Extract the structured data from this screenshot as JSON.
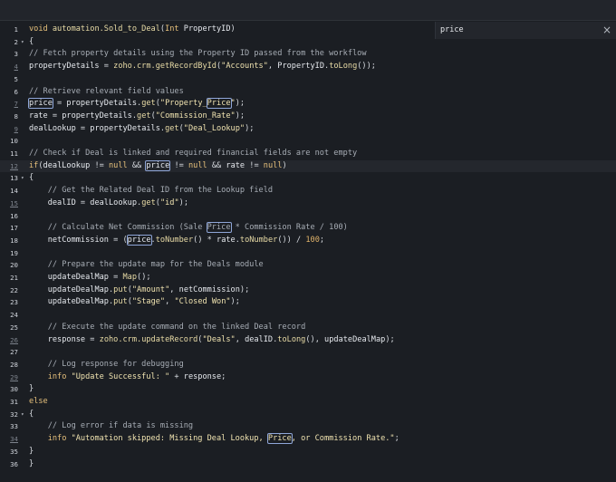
{
  "search": {
    "value": "price",
    "close_label": "×"
  },
  "editor": {
    "lines": [
      {
        "n": "1",
        "fold": false,
        "tokens": [
          [
            "kw",
            "void "
          ],
          [
            "fn",
            "automation.Sold_to_Deal"
          ],
          [
            "op",
            "("
          ],
          [
            "kw",
            "Int "
          ],
          [
            "var",
            "PropertyID"
          ],
          [
            "op",
            ")"
          ]
        ]
      },
      {
        "n": "2",
        "fold": true,
        "tokens": [
          [
            "op",
            "{"
          ]
        ]
      },
      {
        "n": "3",
        "fold": false,
        "tokens": [
          [
            "cm",
            "// Fetch property details using the Property ID passed from the workflow"
          ]
        ]
      },
      {
        "n": "4",
        "fold": false,
        "tokens": [
          [
            "var",
            "propertyDetails"
          ],
          [
            "op",
            " = "
          ],
          [
            "fn",
            "zoho.crm.getRecordById"
          ],
          [
            "op",
            "("
          ],
          [
            "str",
            "\"Accounts\""
          ],
          [
            "op",
            ", "
          ],
          [
            "var",
            "PropertyID"
          ],
          [
            "op",
            "."
          ],
          [
            "fn",
            "toLong"
          ],
          [
            "op",
            "());"
          ]
        ]
      },
      {
        "n": "5",
        "fold": false,
        "tokens": []
      },
      {
        "n": "6",
        "fold": false,
        "tokens": [
          [
            "cm",
            "// Retrieve relevant field values"
          ]
        ]
      },
      {
        "n": "7",
        "fold": false,
        "tokens": [
          [
            "hl",
            "price"
          ],
          [
            "op",
            " = "
          ],
          [
            "var",
            "propertyDetails"
          ],
          [
            "op",
            "."
          ],
          [
            "fn",
            "get"
          ],
          [
            "op",
            "("
          ],
          [
            "str",
            "\"Property_"
          ],
          [
            "hlstr",
            "Price"
          ],
          [
            "str",
            "\""
          ],
          [
            "op",
            ");"
          ]
        ]
      },
      {
        "n": "8",
        "fold": false,
        "tokens": [
          [
            "var",
            "rate"
          ],
          [
            "op",
            " = "
          ],
          [
            "var",
            "propertyDetails"
          ],
          [
            "op",
            "."
          ],
          [
            "fn",
            "get"
          ],
          [
            "op",
            "("
          ],
          [
            "str",
            "\"Commission_Rate\""
          ],
          [
            "op",
            ");"
          ]
        ]
      },
      {
        "n": "9",
        "fold": false,
        "tokens": [
          [
            "var",
            "dealLookup"
          ],
          [
            "op",
            " = "
          ],
          [
            "var",
            "propertyDetails"
          ],
          [
            "op",
            "."
          ],
          [
            "fn",
            "get"
          ],
          [
            "op",
            "("
          ],
          [
            "str",
            "\"Deal_Lookup\""
          ],
          [
            "op",
            ");"
          ]
        ]
      },
      {
        "n": "10",
        "fold": false,
        "tokens": []
      },
      {
        "n": "11",
        "fold": false,
        "tokens": [
          [
            "cm",
            "// Check if Deal is linked and required financial fields are not empty"
          ]
        ]
      },
      {
        "n": "12",
        "fold": false,
        "active": true,
        "tokens": [
          [
            "kw",
            "if"
          ],
          [
            "op",
            "("
          ],
          [
            "var",
            "dealLookup"
          ],
          [
            "op",
            " != "
          ],
          [
            "kw",
            "null"
          ],
          [
            "op",
            " && "
          ],
          [
            "hl",
            "price"
          ],
          [
            "op",
            " != "
          ],
          [
            "kw",
            "null"
          ],
          [
            "op",
            " && "
          ],
          [
            "var",
            "rate"
          ],
          [
            "op",
            " != "
          ],
          [
            "kw",
            "null"
          ],
          [
            "op",
            ")"
          ]
        ]
      },
      {
        "n": "13",
        "fold": true,
        "tokens": [
          [
            "op",
            "{"
          ]
        ]
      },
      {
        "n": "14",
        "fold": false,
        "tokens": [
          [
            "op",
            "    "
          ],
          [
            "cm",
            "// Get the Related Deal ID from the Lookup field"
          ]
        ]
      },
      {
        "n": "15",
        "fold": false,
        "tokens": [
          [
            "op",
            "    "
          ],
          [
            "var",
            "dealID"
          ],
          [
            "op",
            " = "
          ],
          [
            "var",
            "dealLookup"
          ],
          [
            "op",
            "."
          ],
          [
            "fn",
            "get"
          ],
          [
            "op",
            "("
          ],
          [
            "str",
            "\"id\""
          ],
          [
            "op",
            ");"
          ]
        ]
      },
      {
        "n": "16",
        "fold": false,
        "tokens": []
      },
      {
        "n": "17",
        "fold": false,
        "tokens": [
          [
            "op",
            "    "
          ],
          [
            "cm",
            "// Calculate Net Commission (Sale "
          ],
          [
            "hlcm",
            "Price"
          ],
          [
            "cm",
            " * Commission Rate / 100)"
          ]
        ]
      },
      {
        "n": "18",
        "fold": false,
        "tokens": [
          [
            "op",
            "    "
          ],
          [
            "var",
            "netCommission"
          ],
          [
            "op",
            " = ("
          ],
          [
            "hl",
            "price"
          ],
          [
            "op",
            "."
          ],
          [
            "fn",
            "toNumber"
          ],
          [
            "op",
            "() * "
          ],
          [
            "var",
            "rate"
          ],
          [
            "op",
            "."
          ],
          [
            "fn",
            "toNumber"
          ],
          [
            "op",
            "()) / "
          ],
          [
            "num",
            "100"
          ],
          [
            "op",
            ";"
          ]
        ]
      },
      {
        "n": "19",
        "fold": false,
        "tokens": []
      },
      {
        "n": "20",
        "fold": false,
        "tokens": [
          [
            "op",
            "    "
          ],
          [
            "cm",
            "// Prepare the update map for the Deals module"
          ]
        ]
      },
      {
        "n": "21",
        "fold": false,
        "tokens": [
          [
            "op",
            "    "
          ],
          [
            "var",
            "updateDealMap"
          ],
          [
            "op",
            " = "
          ],
          [
            "fn",
            "Map"
          ],
          [
            "op",
            "();"
          ]
        ]
      },
      {
        "n": "22",
        "fold": false,
        "tokens": [
          [
            "op",
            "    "
          ],
          [
            "var",
            "updateDealMap"
          ],
          [
            "op",
            "."
          ],
          [
            "fn",
            "put"
          ],
          [
            "op",
            "("
          ],
          [
            "str",
            "\"Amount\""
          ],
          [
            "op",
            ", "
          ],
          [
            "var",
            "netCommission"
          ],
          [
            "op",
            ");"
          ]
        ]
      },
      {
        "n": "23",
        "fold": false,
        "tokens": [
          [
            "op",
            "    "
          ],
          [
            "var",
            "updateDealMap"
          ],
          [
            "op",
            "."
          ],
          [
            "fn",
            "put"
          ],
          [
            "op",
            "("
          ],
          [
            "str",
            "\"Stage\""
          ],
          [
            "op",
            ", "
          ],
          [
            "str",
            "\"Closed Won\""
          ],
          [
            "op",
            ");"
          ]
        ]
      },
      {
        "n": "24",
        "fold": false,
        "tokens": []
      },
      {
        "n": "25",
        "fold": false,
        "tokens": [
          [
            "op",
            "    "
          ],
          [
            "cm",
            "// Execute the update command on the linked Deal record"
          ]
        ]
      },
      {
        "n": "26",
        "fold": false,
        "tokens": [
          [
            "op",
            "    "
          ],
          [
            "var",
            "response"
          ],
          [
            "op",
            " = "
          ],
          [
            "fn",
            "zoho.crm.updateRecord"
          ],
          [
            "op",
            "("
          ],
          [
            "str",
            "\"Deals\""
          ],
          [
            "op",
            ", "
          ],
          [
            "var",
            "dealID"
          ],
          [
            "op",
            "."
          ],
          [
            "fn",
            "toLong"
          ],
          [
            "op",
            "(), "
          ],
          [
            "var",
            "updateDealMap"
          ],
          [
            "op",
            ");"
          ]
        ]
      },
      {
        "n": "27",
        "fold": false,
        "tokens": []
      },
      {
        "n": "28",
        "fold": false,
        "tokens": [
          [
            "op",
            "    "
          ],
          [
            "cm",
            "// Log response for debugging"
          ]
        ]
      },
      {
        "n": "29",
        "fold": false,
        "tokens": [
          [
            "op",
            "    "
          ],
          [
            "kw",
            "info "
          ],
          [
            "str",
            "\"Update Successful: \""
          ],
          [
            "op",
            " + "
          ],
          [
            "var",
            "response"
          ],
          [
            "op",
            ";"
          ]
        ]
      },
      {
        "n": "30",
        "fold": false,
        "tokens": [
          [
            "op",
            "}"
          ]
        ]
      },
      {
        "n": "31",
        "fold": false,
        "tokens": [
          [
            "kw",
            "else"
          ]
        ]
      },
      {
        "n": "32",
        "fold": true,
        "tokens": [
          [
            "op",
            "{"
          ]
        ]
      },
      {
        "n": "33",
        "fold": false,
        "tokens": [
          [
            "op",
            "    "
          ],
          [
            "cm",
            "// Log error if data is missing"
          ]
        ]
      },
      {
        "n": "34",
        "fold": false,
        "tokens": [
          [
            "op",
            "    "
          ],
          [
            "kw",
            "info "
          ],
          [
            "str",
            "\"Automation skipped: Missing Deal Lookup, "
          ],
          [
            "hlstr",
            "Price"
          ],
          [
            "str",
            ", or Commission Rate.\""
          ],
          [
            "op",
            ";"
          ]
        ]
      },
      {
        "n": "35",
        "fold": false,
        "tokens": [
          [
            "op",
            "}"
          ]
        ]
      },
      {
        "n": "36",
        "fold": false,
        "tokens": [
          [
            "op",
            "}"
          ]
        ]
      }
    ]
  },
  "colors": {
    "background": "#1b1e23",
    "match_outline": "#8fa6d8"
  }
}
